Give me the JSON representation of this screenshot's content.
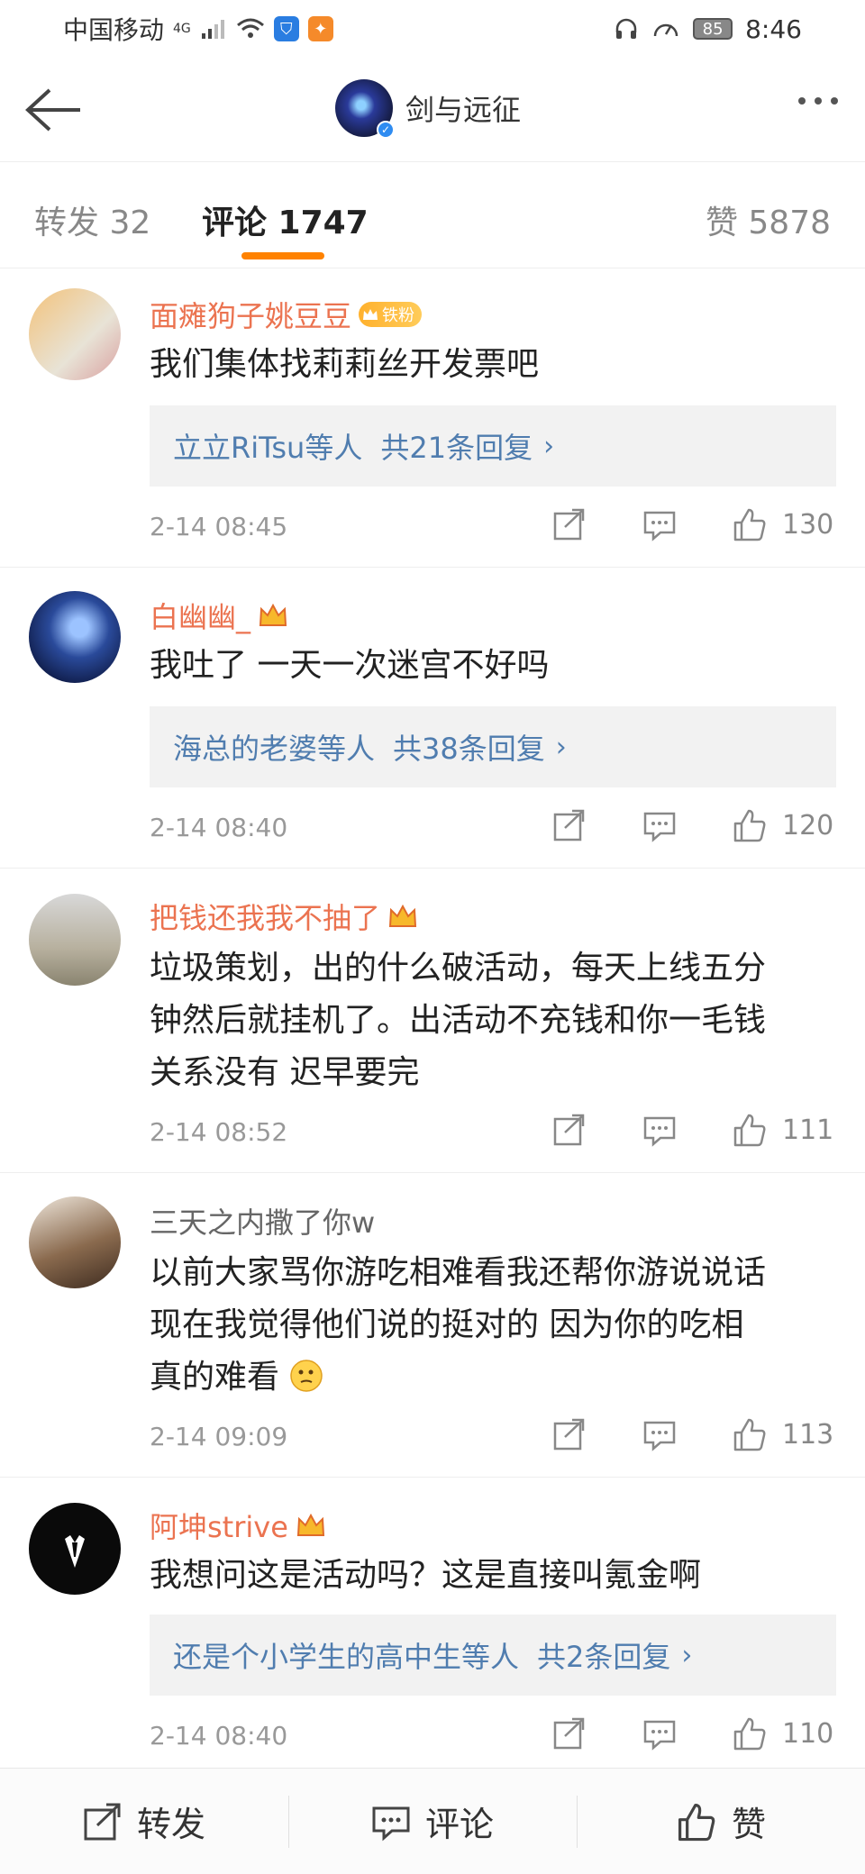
{
  "status_bar": {
    "carrier": "中国移动",
    "network": "4G",
    "battery": "85",
    "time": "8:46"
  },
  "header": {
    "title": "剑与远征"
  },
  "tabs": [
    {
      "label": "转发 32"
    },
    {
      "label": "评论 1747"
    },
    {
      "label": "赞 5878"
    }
  ],
  "comments": [
    {
      "user": "面瘫狗子姚豆豆",
      "badge": "铁粉",
      "text": "我们集体找莉莉丝开发票吧",
      "reply": {
        "who": "立立RiTsu等人",
        "count": "共21条回复"
      },
      "time": "2-14 08:45",
      "likes": "130"
    },
    {
      "user": "白幽幽_",
      "text": "我吐了 一天一次迷宫不好吗",
      "reply": {
        "who": "海总的老婆等人",
        "count": "共38条回复"
      },
      "time": "2-14 08:40",
      "likes": "120"
    },
    {
      "user": "把钱还我我不抽了",
      "text_lines": [
        "垃圾策划，出的什么破活动，每天上线五分",
        "钟然后就挂机了。出活动不充钱和你一毛钱",
        "关系没有 迟早要完"
      ],
      "time": "2-14 08:52",
      "likes": "111"
    },
    {
      "user": "三天之内撒了你w",
      "text_lines": [
        "以前大家骂你游吃相难看我还帮你游说说话",
        "现在我觉得他们说的挺对的  因为你的吃相",
        "真的难看"
      ],
      "time": "2-14 09:09",
      "likes": "113"
    },
    {
      "user": "阿坤strive",
      "text": "我想问这是活动吗？这是直接叫氪金啊",
      "reply": {
        "who": "还是个小学生的高中生等人",
        "count": "共2条回复"
      },
      "time": "2-14 08:40",
      "likes": "110"
    }
  ],
  "bottom_bar": {
    "repost": "转发",
    "comment": "评论",
    "like": "赞"
  },
  "colors": {
    "accent": "#ff8200",
    "username": "#eb7350",
    "reply_link": "#507daf"
  }
}
